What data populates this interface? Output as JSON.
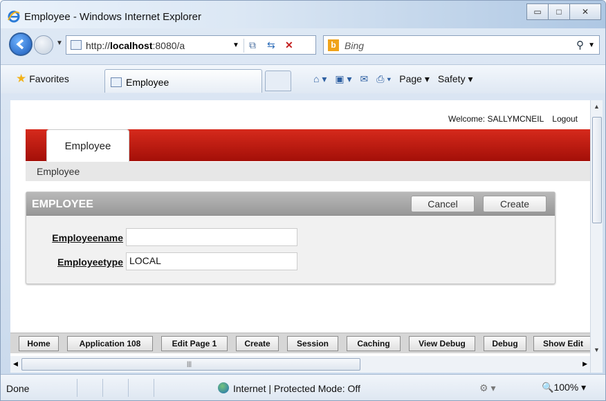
{
  "window": {
    "title": "Employee - Windows Internet Explorer",
    "minimize": "▭",
    "maximize": "□",
    "close": "✕"
  },
  "nav": {
    "url_prefix": "http://",
    "url_host": "localhost",
    "url_rest": ":8080/a",
    "search_placeholder": "Bing"
  },
  "favorites": {
    "label": "Favorites",
    "tab_label": "Employee"
  },
  "commands": {
    "page": "Page ▾",
    "safety": "Safety ▾"
  },
  "header": {
    "welcome": "Welcome: SALLYMCNEIL",
    "logout": "Logout"
  },
  "app_tab": "Employee",
  "breadcrumb": "Employee",
  "region": {
    "title": "EMPLOYEE",
    "cancel": "Cancel",
    "create": "Create",
    "fields": {
      "name_label": "Employeename",
      "name_value": "",
      "type_label": "Employeetype",
      "type_value": "LOCAL"
    }
  },
  "dev_toolbar": [
    "Home",
    "Application 108",
    "Edit Page 1",
    "Create",
    "Session",
    "Caching",
    "View Debug",
    "Debug",
    "Show Edit"
  ],
  "status": {
    "done": "Done",
    "zone": "Internet | Protected Mode: Off",
    "zoom": "100%"
  }
}
